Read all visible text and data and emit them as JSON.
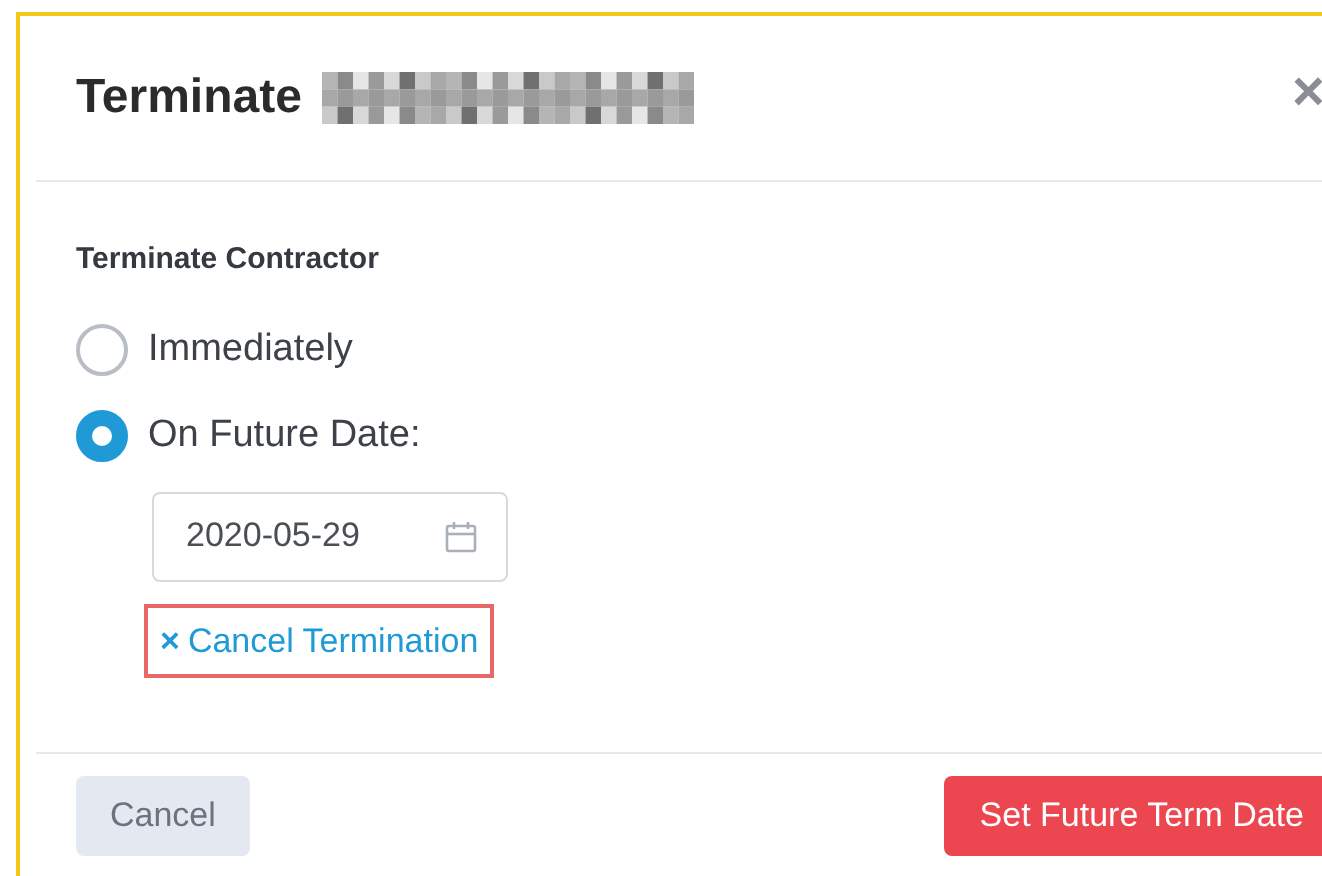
{
  "dialog": {
    "title": "Terminate",
    "name_redacted": true,
    "close": "×"
  },
  "section_label": "Terminate Contractor",
  "options": [
    {
      "label": "Immediately",
      "selected": false
    },
    {
      "label": "On Future Date:",
      "selected": true
    }
  ],
  "date_field": {
    "value": "2020-05-29"
  },
  "cancel_link": {
    "icon": "×",
    "label": "Cancel Termination",
    "highlighted": true
  },
  "buttons": [
    {
      "label": "Cancel",
      "kind": "secondary"
    },
    {
      "label": "Set Future Term Date",
      "kind": "danger"
    }
  ]
}
